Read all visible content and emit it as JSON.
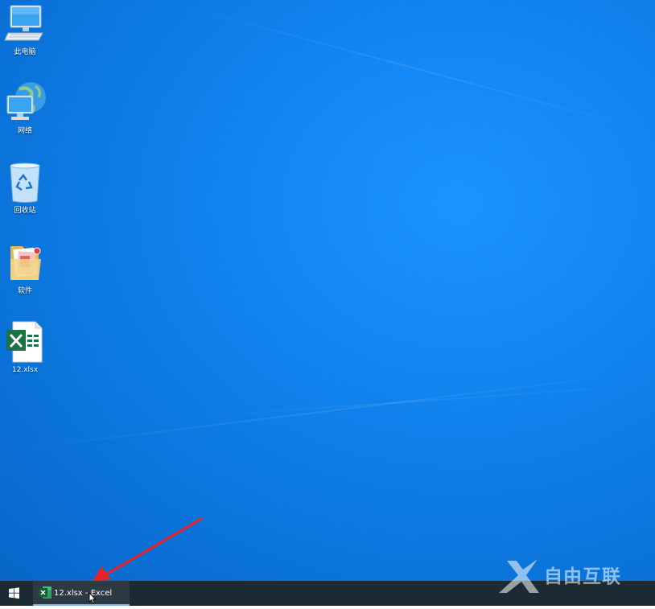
{
  "desktop": {
    "icons": [
      {
        "label": "此电脑",
        "icon": "computer-icon"
      },
      {
        "label": "网络",
        "icon": "network-icon"
      },
      {
        "label": "回收站",
        "icon": "recycle-bin-icon"
      },
      {
        "label": "软件",
        "icon": "folder-icon"
      },
      {
        "label": "12.xlsx",
        "icon": "excel-file-icon"
      }
    ]
  },
  "taskbar": {
    "start_icon": "windows-logo-icon",
    "app_label": "12.xlsx - Excel",
    "app_icon": "excel-icon"
  },
  "annotation": {
    "arrow_color": "#e8232a"
  },
  "watermark": {
    "text": "自由互联"
  }
}
